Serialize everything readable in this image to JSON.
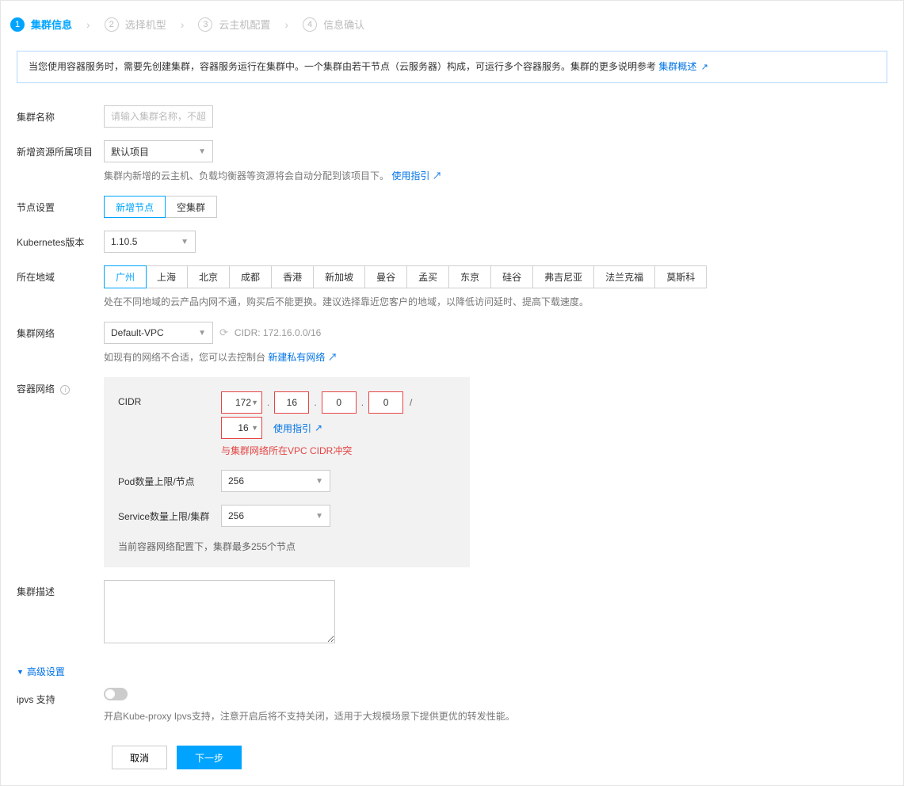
{
  "stepper": {
    "steps": [
      {
        "num": "1",
        "label": "集群信息",
        "active": true
      },
      {
        "num": "2",
        "label": "选择机型",
        "active": false
      },
      {
        "num": "3",
        "label": "云主机配置",
        "active": false
      },
      {
        "num": "4",
        "label": "信息确认",
        "active": false
      }
    ]
  },
  "banner": {
    "text": "当您使用容器服务时，需要先创建集群，容器服务运行在集群中。一个集群由若干节点（云服务器）构成，可运行多个容器服务。集群的更多说明参考 ",
    "link_label": "集群概述",
    "ext": "↗"
  },
  "form": {
    "cluster_name": {
      "label": "集群名称",
      "placeholder": "请输入集群名称，不超过"
    },
    "project": {
      "label": "新增资源所属项目",
      "value": "默认项目",
      "help_prefix": "集群内新增的云主机、负载均衡器等资源将会自动分配到该项目下。",
      "help_link": "使用指引",
      "ext": "↗"
    },
    "node_setting": {
      "label": "节点设置",
      "options": [
        "新增节点",
        "空集群"
      ],
      "active": 0
    },
    "k8s": {
      "label": "Kubernetes版本",
      "value": "1.10.5"
    },
    "region": {
      "label": "所在地域",
      "tabs": [
        "广州",
        "上海",
        "北京",
        "成都",
        "香港",
        "新加坡",
        "曼谷",
        "孟买",
        "东京",
        "硅谷",
        "弗吉尼亚",
        "法兰克福",
        "莫斯科"
      ],
      "active": 0,
      "help": "处在不同地域的云产品内网不通，购买后不能更换。建议选择靠近您客户的地域，以降低访问延时、提高下载速度。"
    },
    "network": {
      "label": "集群网络",
      "value": "Default-VPC",
      "cidr_label": "CIDR: 172.16.0.0/16",
      "help_prefix": "如现有的网络不合适，您可以去控制台 ",
      "help_link": "新建私有网络",
      "ext": "↗"
    },
    "container_net": {
      "label": "容器网络",
      "cidr_label": "CIDR",
      "cidr_link": "使用指引",
      "ext": "↗",
      "octets": [
        "172",
        "16",
        "0",
        "0"
      ],
      "mask": "16",
      "error": "与集群网络所在VPC CIDR冲突",
      "pods": {
        "label": "Pod数量上限/节点",
        "value": "256"
      },
      "services": {
        "label": "Service数量上限/集群",
        "value": "256"
      },
      "note": "当前容器网络配置下，集群最多255个节点"
    },
    "desc": {
      "label": "集群描述",
      "value": ""
    },
    "advanced": {
      "toggle": "高级设置"
    },
    "ipvs": {
      "label": "ipvs 支持",
      "help": "开启Kube-proxy Ipvs支持，注意开启后将不支持关闭，适用于大规模场景下提供更优的转发性能。"
    }
  },
  "footer": {
    "cancel": "取消",
    "next": "下一步"
  }
}
